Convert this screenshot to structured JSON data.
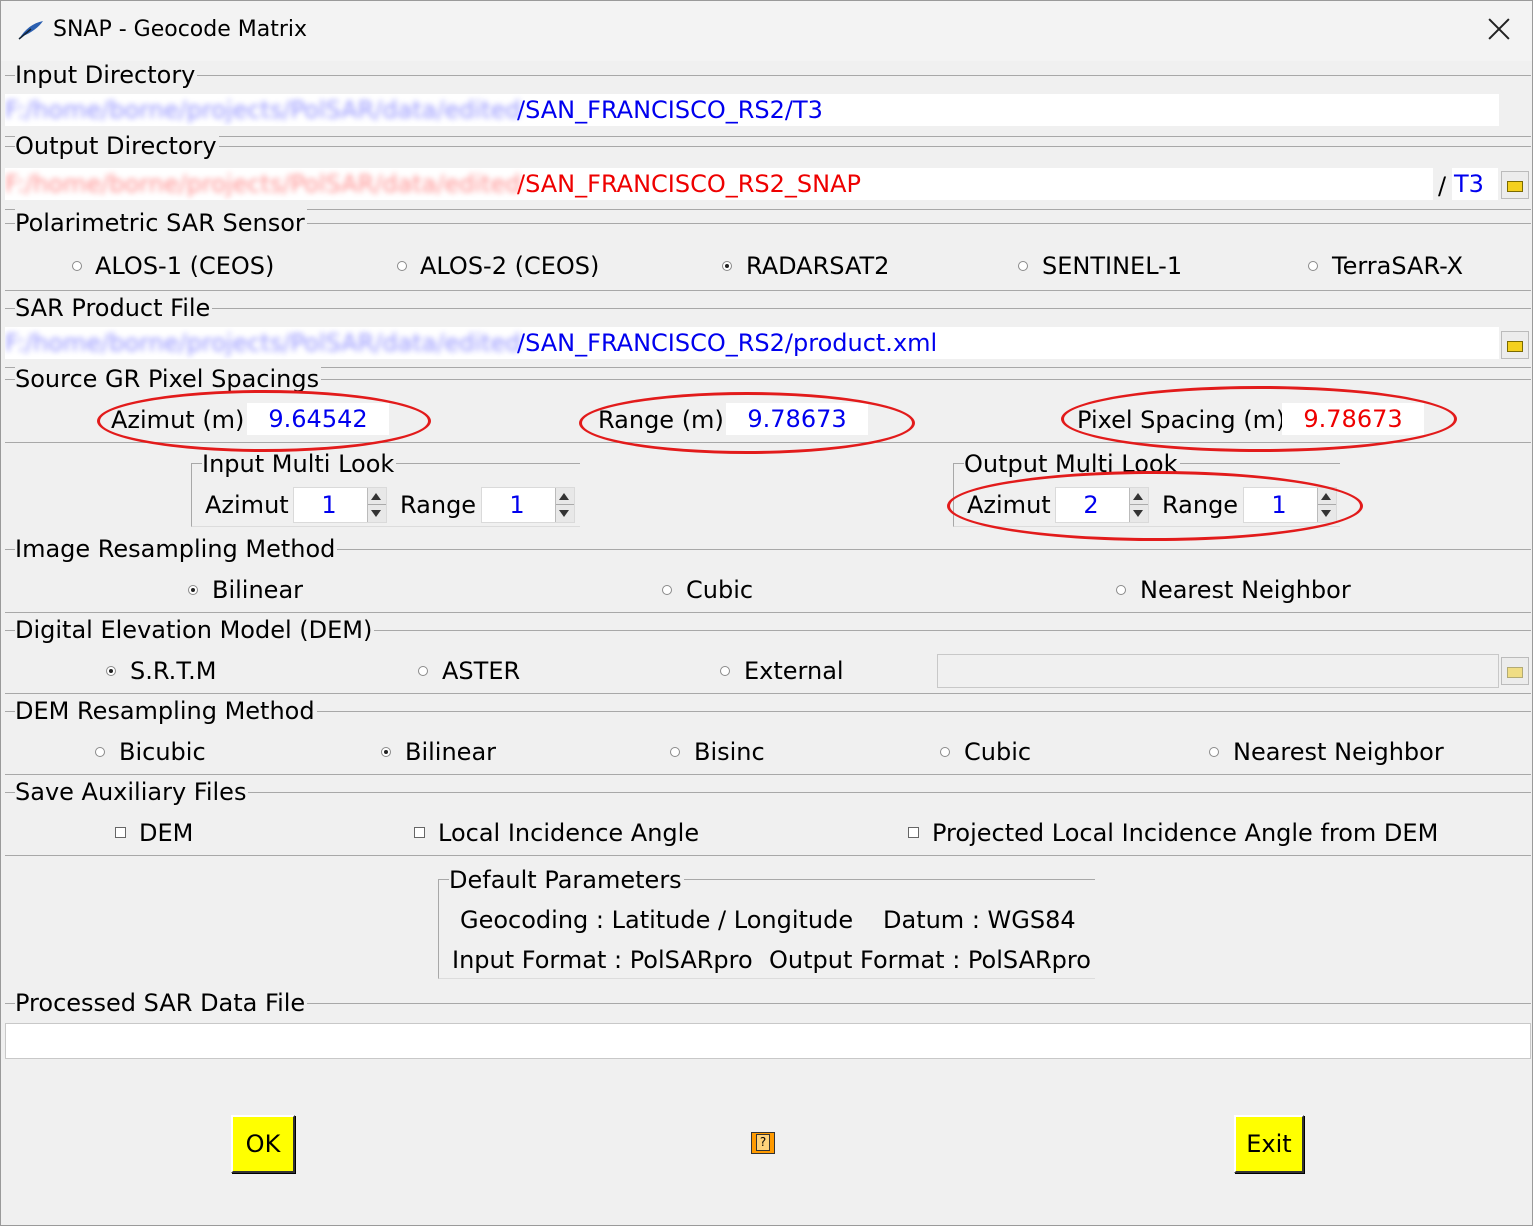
{
  "window": {
    "title": "SNAP - Geocode Matrix"
  },
  "input_directory": {
    "legend": "Input Directory",
    "prefix_blurred": "F:/home/borne/projects/PolSAR/data/edited",
    "suffix": "/SAN_FRANCISCO_RS2/T3"
  },
  "output_directory": {
    "legend": "Output Directory",
    "prefix_blurred": "F:/home/borne/projects/PolSAR/data/edited",
    "suffix": "/SAN_FRANCISCO_RS2_SNAP",
    "separator": "/",
    "subdir": "T3"
  },
  "sensor": {
    "legend": "Polarimetric SAR Sensor",
    "options": [
      "ALOS-1 (CEOS)",
      "ALOS-2 (CEOS)",
      "RADARSAT2",
      "SENTINEL-1",
      "TerraSAR-X"
    ],
    "selected": "RADARSAT2"
  },
  "product_file": {
    "legend": "SAR Product File",
    "prefix_blurred": "F:/home/borne/projects/PolSAR/data/edited",
    "suffix": "/SAN_FRANCISCO_RS2/product.xml"
  },
  "pixel_spacing": {
    "legend": "Source GR Pixel Spacings",
    "azimut_label": "Azimut (m)",
    "azimut_value": "9.64542",
    "range_label": "Range (m)",
    "range_value": "9.78673",
    "pixel_label": "Pixel Spacing (m)",
    "pixel_value": "9.78673"
  },
  "input_multilook": {
    "legend": "Input Multi Look",
    "azimut_label": "Azimut",
    "azimut_value": "1",
    "range_label": "Range",
    "range_value": "1"
  },
  "output_multilook": {
    "legend": "Output Multi Look",
    "azimut_label": "Azimut",
    "azimut_value": "2",
    "range_label": "Range",
    "range_value": "1"
  },
  "image_resampling": {
    "legend": "Image Resampling Method",
    "options": [
      "Bilinear",
      "Cubic",
      "Nearest Neighbor"
    ],
    "selected": "Bilinear"
  },
  "dem": {
    "legend": "Digital Elevation Model (DEM)",
    "options": [
      "S.R.T.M",
      "ASTER",
      "External"
    ],
    "selected": "S.R.T.M",
    "external_path": ""
  },
  "dem_resampling": {
    "legend": "DEM Resampling Method",
    "options": [
      "Bicubic",
      "Bilinear",
      "Bisinc",
      "Cubic",
      "Nearest Neighbor"
    ],
    "selected": "Bilinear"
  },
  "aux_files": {
    "legend": "Save Auxiliary Files",
    "options": [
      "DEM",
      "Local Incidence Angle",
      "Projected Local Incidence Angle from DEM"
    ]
  },
  "defaults": {
    "legend": "Default Parameters",
    "geocoding": "Geocoding : Latitude / Longitude",
    "datum": "Datum : WGS84",
    "input_format": "Input Format : PolSARpro",
    "output_format": "Output Format : PolSARpro"
  },
  "processed_file": {
    "legend": "Processed SAR Data File",
    "value": ""
  },
  "buttons": {
    "ok": "OK",
    "exit": "Exit",
    "help_icon": "help-icon"
  },
  "colors": {
    "value_blue": "#0000ee",
    "value_red": "#ee0000",
    "annotation_red": "#e21b1b",
    "button_yellow": "#ffff00"
  }
}
